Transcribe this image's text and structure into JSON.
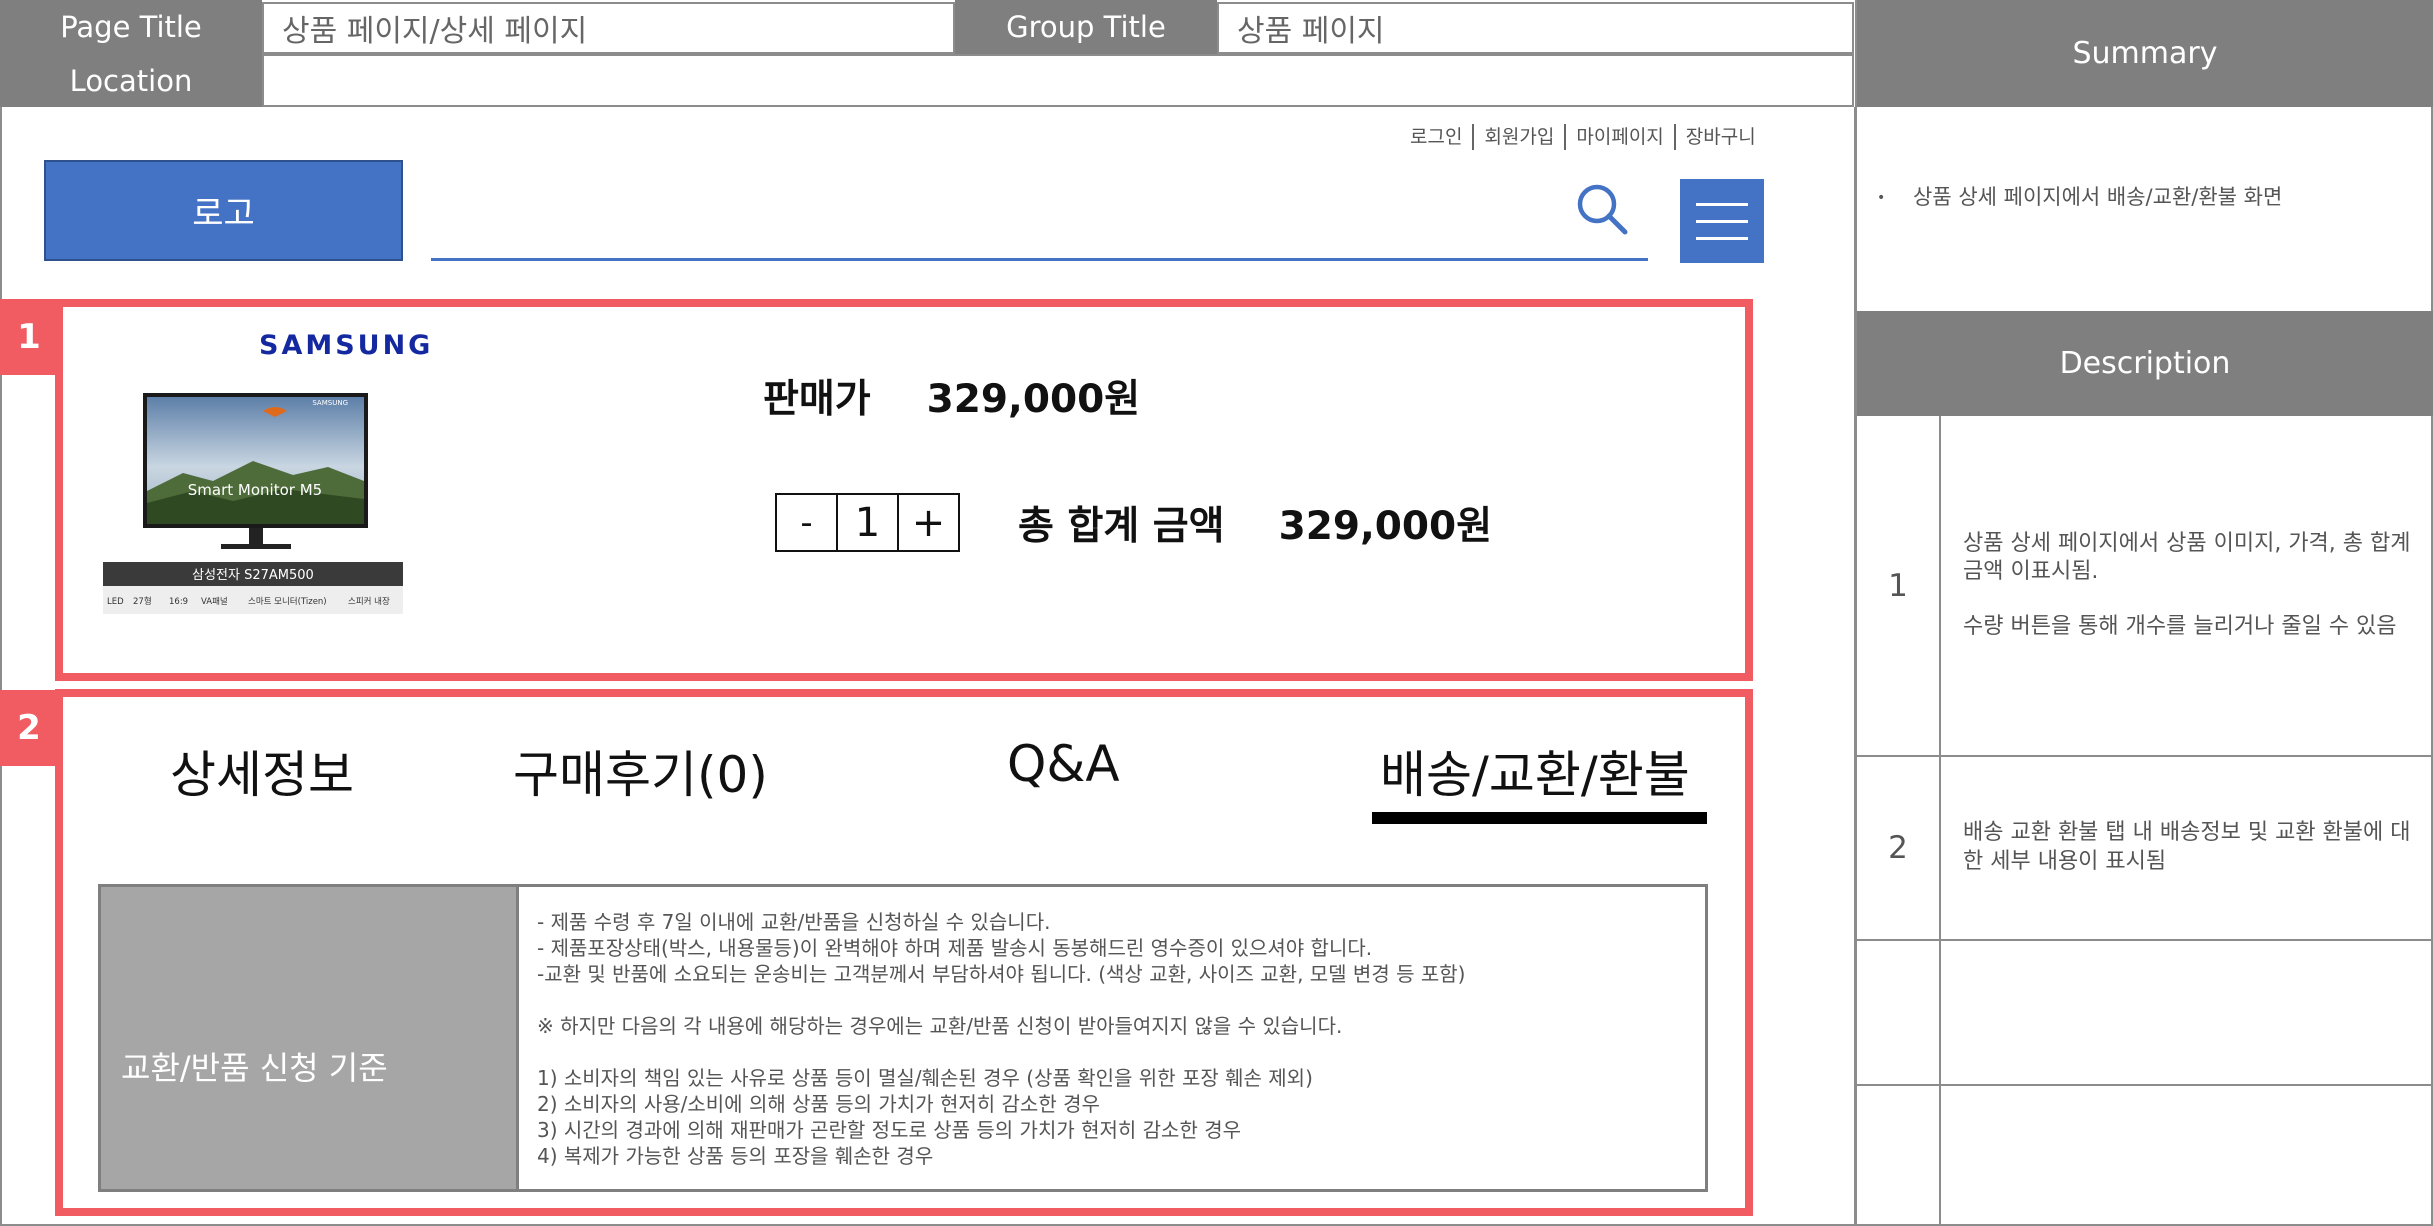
{
  "header": {
    "page_title_label": "Page Title",
    "page_title_value": "상품 페이지/상세 페이지",
    "group_title_label": "Group Title",
    "group_title_value": "상품 페이지",
    "location_label": "Location",
    "location_value": ""
  },
  "summary": {
    "title": "Summary",
    "items": [
      "상품 상세 페이지에서 배송/교환/환불 화면"
    ]
  },
  "description": {
    "title": "Description",
    "rows": [
      {
        "num": "1",
        "lines": [
          "상품 상세 페이지에서 상품 이미지, 가격, 총 합계금액 이표시됨.",
          "수량 버튼을 통해 개수를 늘리거나 줄일 수 있음"
        ]
      },
      {
        "num": "2",
        "lines": [
          "배송 교환 환불 탭 내 배송정보 및 교환 환불에 대한 세부 내용이 표시됨"
        ]
      },
      {
        "num": "",
        "lines": []
      },
      {
        "num": "",
        "lines": []
      }
    ]
  },
  "site": {
    "top_links": [
      "로그인",
      "회원가입",
      "마이페이지",
      "장바구니"
    ],
    "logo_label": "로고",
    "icons": {
      "search": "search-icon",
      "menu": "hamburger-menu-icon"
    },
    "colors": {
      "primary": "#4472c4",
      "annotation": "#f05c62"
    }
  },
  "annotations": {
    "box1": "1",
    "box2": "2"
  },
  "product": {
    "brand": "SAMSUNG",
    "image": {
      "screen_brand": "SAMSUNG",
      "screen_text": "Smart Monitor M5",
      "model": "삼성전자 S27AM500",
      "specs": [
        "LED",
        "27형",
        "16:9",
        "VA패널",
        "스마트 모니터(Tizen)",
        "스피커 내장"
      ]
    },
    "price_label": "판매가",
    "price_value": "329,000원",
    "qty_minus": "-",
    "qty_value": "1",
    "qty_plus": "+",
    "total_label": "총 합계 금액",
    "total_value": "329,000원"
  },
  "tabs": [
    {
      "label": "상세정보",
      "active": false
    },
    {
      "label": "구매후기(0)",
      "active": false
    },
    {
      "label": "Q&A",
      "active": false
    },
    {
      "label": "배송/교환/환불",
      "active": true
    }
  ],
  "policy": {
    "label": "교환/반품 신청 기준",
    "lines": [
      "- 제품 수령 후 7일 이내에 교환/반품을 신청하실 수 있습니다.",
      "- 제품포장상태(박스, 내용물등)이 완벽해야 하며 제품 발송시 동봉해드린 영수증이 있으셔야 합니다.",
      "-교환 및 반품에 소요되는 운송비는 고객분께서 부담하셔야 됩니다. (색상 교환, 사이즈 교환, 모델 변경 등 포함)",
      "",
      "※ 하지만 다음의 각 내용에 해당하는 경우에는 교환/반품 신청이 받아들여지지 않을 수 있습니다.",
      "",
      "1) 소비자의 책임 있는 사유로 상품 등이 멸실/훼손된 경우 (상품 확인을 위한 포장 훼손 제외)",
      "2) 소비자의 사용/소비에 의해 상품 등의 가치가 현저히 감소한 경우",
      "3) 시간의 경과에 의해 재판매가 곤란할 정도로 상품 등의 가치가 현저히 감소한 경우",
      "4) 복제가 가능한 상품 등의 포장을 훼손한 경우"
    ]
  }
}
